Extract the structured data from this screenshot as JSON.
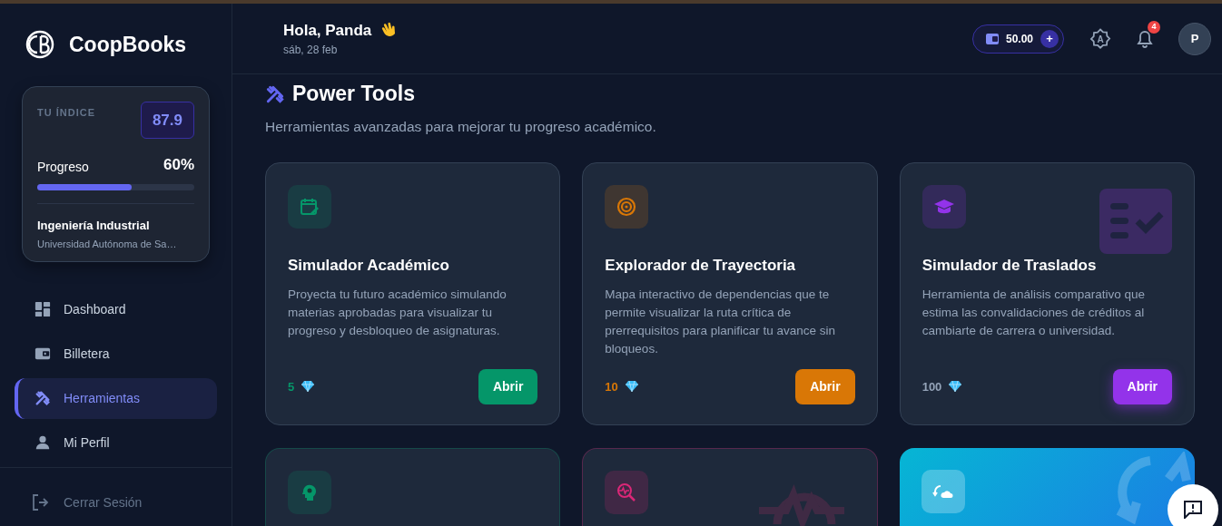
{
  "sidebar": {
    "brand": "CoopBooks",
    "index_card": {
      "label": "TU ÍNDICE",
      "value": "87.9",
      "progress_label": "Progreso",
      "progress_value": "60%",
      "level": 0.6,
      "career": "Ingeniería Industrial",
      "university": "Universidad Autónoma de Sa…"
    },
    "items": [
      {
        "label": "Dashboard",
        "selected": false
      },
      {
        "label": "Billetera",
        "selected": false
      },
      {
        "label": "Herramientas",
        "selected": true
      },
      {
        "label": "Mi Perfil",
        "selected": false
      }
    ],
    "logout": "Cerrar Sesión"
  },
  "header": {
    "greeting": "Hola, Panda",
    "date": "sáb, 28 feb",
    "balance": "50.00",
    "add_button": "+",
    "theme_letter": "A",
    "notifications": "4",
    "avatar": "P"
  },
  "page": {
    "title": "Power Tools",
    "subtitle": "Herramientas avanzadas para mejorar tu progreso académico."
  },
  "tools": [
    {
      "kind": "card",
      "color": "#059669",
      "title": "Simulador Académico",
      "description": "Proyecta tu futuro académico simulando materias aprobadas para visualizar tu progreso y desbloqueo de asignaturas.",
      "cost": "5",
      "button": "Abrir"
    },
    {
      "kind": "card",
      "color": "#d97706",
      "title": "Explorador de Trayectoria",
      "description": "Mapa interactivo de dependencias que te permite visualizar la ruta crítica de prerrequisitos para planificar tu avance sin bloqueos.",
      "cost": "10",
      "button": "Abrir"
    },
    {
      "kind": "card",
      "color": "#9333ea",
      "title": "Simulador de Traslados",
      "description": "Herramienta de análisis comparativo que estima las convalidaciones de créditos al cambiarte de carrera o universidad.",
      "cost": "100",
      "button": "Abrir"
    },
    {
      "kind": "card",
      "color": "#059669"
    },
    {
      "kind": "card",
      "color": "#db2777"
    },
    {
      "kind": "featured",
      "color": "#0ea5e9"
    }
  ]
}
